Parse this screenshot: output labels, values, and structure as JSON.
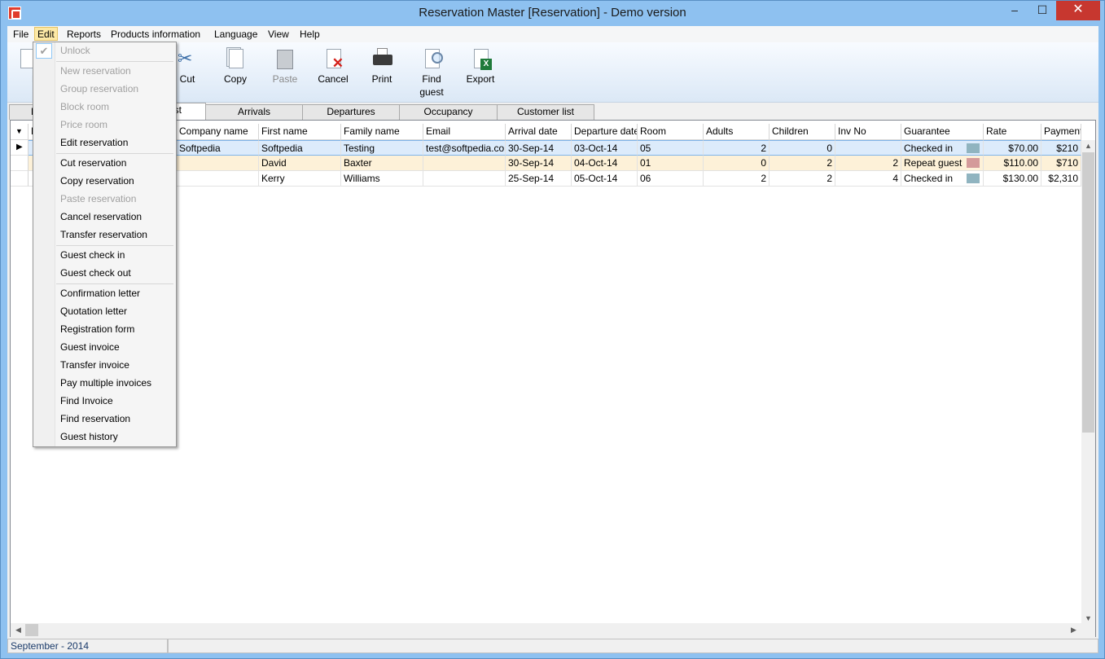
{
  "window": {
    "title": "Reservation Master [Reservation] - Demo version",
    "minimize": "–",
    "maximize": "☐",
    "close": "✕"
  },
  "menubar": [
    "File",
    "Edit",
    "Reports",
    "Products information",
    "Language",
    "View",
    "Help"
  ],
  "toolbar": {
    "cut": "Cut",
    "copy": "Copy",
    "paste": "Paste",
    "cancel": "Cancel",
    "print": "Print",
    "find_guest": "Find guest",
    "export": "Export",
    "partial_left_label": "N"
  },
  "tabs": {
    "hidden_left": "B",
    "current_partial": "st",
    "arrivals": "Arrivals",
    "departures": "Departures",
    "occupancy": "Occupancy",
    "customer_list": "Customer list"
  },
  "grid": {
    "partial_first_col": "F",
    "columns": [
      "Company name",
      "First name",
      "Family name",
      "Email",
      "Arrival date",
      "Departure date",
      "Room",
      "Adults",
      "Children",
      "Inv No",
      "Guarantee",
      "Rate",
      "Payment"
    ],
    "rows": [
      {
        "company": "Softpedia",
        "first": "Softpedia",
        "family": "Testing",
        "email": "test@softpedia.com",
        "arrival": "30-Sep-14",
        "departure": "03-Oct-14",
        "room": "05",
        "adults": "2",
        "children": "0",
        "inv": "",
        "guarantee": "Checked in",
        "swatch": "#90b4c0",
        "rate": "$70.00",
        "payment": "$210"
      },
      {
        "company": "",
        "first": "David",
        "family": "Baxter",
        "email": "",
        "arrival": "30-Sep-14",
        "departure": "04-Oct-14",
        "room": "01",
        "adults": "0",
        "children": "2",
        "inv": "2",
        "guarantee": "Repeat guest",
        "swatch": "#d49a9a",
        "rate": "$110.00",
        "payment": "$710"
      },
      {
        "company": "",
        "first": "Kerry",
        "family": "Williams",
        "email": "",
        "arrival": "25-Sep-14",
        "departure": "05-Oct-14",
        "room": "06",
        "adults": "2",
        "children": "2",
        "inv": "4",
        "guarantee": "Checked in",
        "swatch": "#90b4c0",
        "rate": "$130.00",
        "payment": "$2,310"
      }
    ]
  },
  "status": {
    "period": "September - 2014"
  },
  "edit_menu": {
    "unlock": "Unlock",
    "new_reservation": "New reservation",
    "group_reservation": "Group reservation",
    "block_room": "Block room",
    "price_room": "Price room",
    "edit_reservation": "Edit reservation",
    "cut_reservation": "Cut reservation",
    "copy_reservation": "Copy reservation",
    "paste_reservation": "Paste reservation",
    "cancel_reservation": "Cancel reservation",
    "transfer_reservation": "Transfer reservation",
    "guest_check_in": "Guest check in",
    "guest_check_out": "Guest check out",
    "confirmation_letter": "Confirmation letter",
    "quotation_letter": "Quotation letter",
    "registration_form": "Registration form",
    "guest_invoice": "Guest invoice",
    "transfer_invoice": "Transfer invoice",
    "pay_multiple_invoices": "Pay multiple invoices",
    "find_invoice": "Find Invoice",
    "find_reservation": "Find reservation",
    "guest_history": "Guest history"
  },
  "icons": {
    "check": "✔",
    "row_pointer": "▶",
    "sort": "▼",
    "scroll_up": "▲",
    "scroll_down": "▼",
    "scroll_left": "◀",
    "scroll_right": "▶",
    "excel": "X"
  }
}
